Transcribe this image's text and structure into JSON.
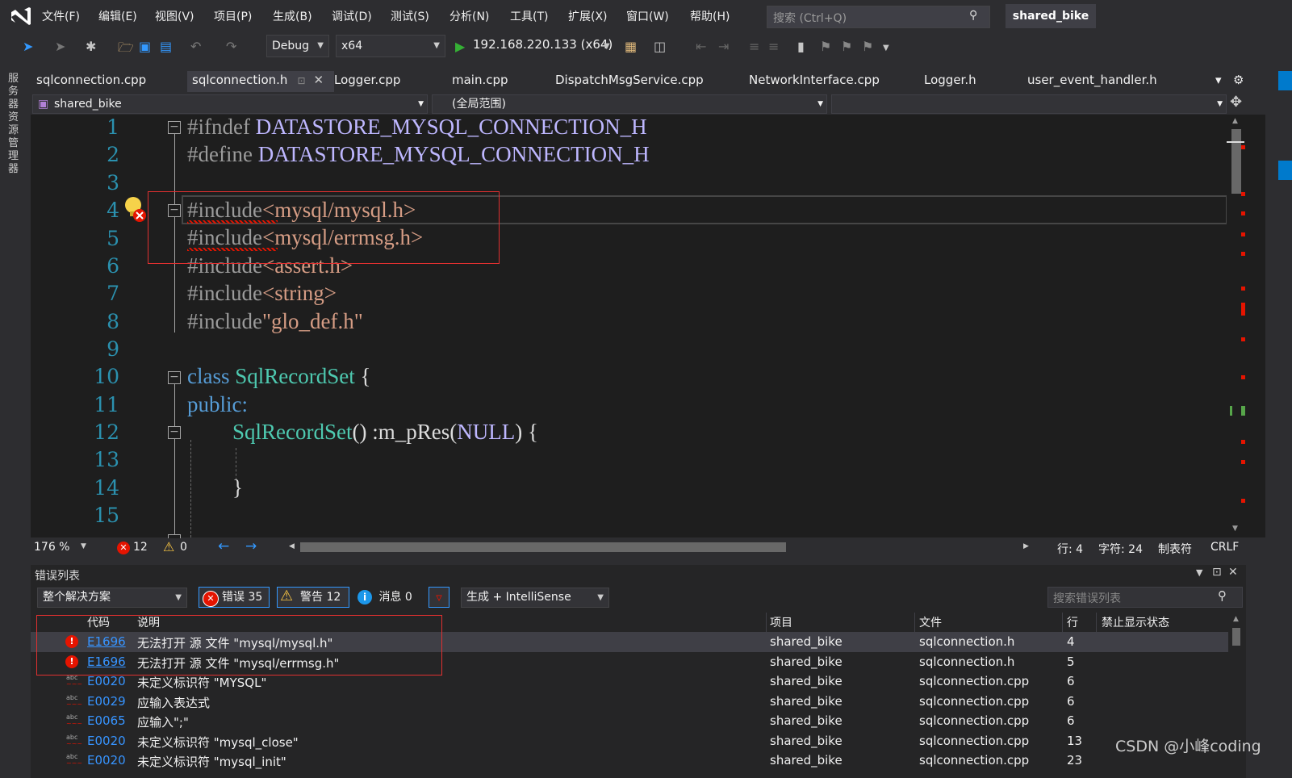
{
  "menu": [
    "文件(F)",
    "编辑(E)",
    "视图(V)",
    "项目(P)",
    "生成(B)",
    "调试(D)",
    "测试(S)",
    "分析(N)",
    "工具(T)",
    "扩展(X)",
    "窗口(W)",
    "帮助(H)"
  ],
  "search": {
    "placeholder": "搜索 (Ctrl+Q)"
  },
  "project_name": "shared_bike",
  "toolbar": {
    "config": "Debug",
    "platform": "x64",
    "run_target": "192.168.220.133 (x64)"
  },
  "left_sidebar_label": "服务器资源管理器",
  "tabs": [
    "sqlconnection.cpp",
    "sqlconnection.h",
    "Logger.cpp",
    "main.cpp",
    "DispatchMsgService.cpp",
    "NetworkInterface.cpp",
    "Logger.h",
    "user_event_handler.h"
  ],
  "active_tab": "sqlconnection.h",
  "nav": {
    "project": "shared_bike",
    "scope": "(全局范围)"
  },
  "line_numbers": [
    "1",
    "2",
    "3",
    "4",
    "5",
    "6",
    "7",
    "8",
    "9",
    "10",
    "11",
    "12",
    "13",
    "14",
    "15"
  ],
  "code": {
    "l1_dir": "#ifndef",
    "l1_mac": "DATASTORE_MYSQL_CONNECTION_H",
    "l2_dir": "#define",
    "l2_mac": "DATASTORE_MYSQL_CONNECTION_H",
    "l4_dir": "#include",
    "l4_str": "<mysql/mysql.h>",
    "l5_dir": "#include",
    "l5_str": "<mysql/errmsg.h>",
    "l6_dir": "#include",
    "l6_str": "<assert.h>",
    "l7_dir": "#include",
    "l7_str": "<string>",
    "l8_dir": "#include",
    "l8_str": "\"glo_def.h\"",
    "l10_kw": "class",
    "l10_ty": "SqlRecordSet",
    "l10_rest": "{",
    "l11_kw": "public:",
    "l12_ty": "SqlRecordSet",
    "l12_a": "()",
    "l12_b": " :m_pRes(",
    "l12_mac": "NULL",
    "l12_c": ")",
    "l12_d": "{",
    "l14": "}"
  },
  "status": {
    "zoom": "176 %",
    "errors": "12",
    "warnings": "0",
    "line": "行: 4",
    "char": "字符: 24",
    "tabs": "制表符",
    "eol": "CRLF"
  },
  "error_list": {
    "title": "错误列表",
    "scope": "整个解决方案",
    "errors_btn": "错误 35",
    "warnings_btn": "警告 12",
    "messages_btn": "消息 0",
    "source": "生成 + IntelliSense",
    "search_placeholder": "搜索错误列表",
    "columns": {
      "code": "代码",
      "desc": "说明",
      "project": "项目",
      "file": "文件",
      "line": "行",
      "suppress": "禁止显示状态"
    },
    "rows": [
      {
        "code": "E1696",
        "desc": "无法打开 源 文件 \"mysql/mysql.h\"",
        "project": "shared_bike",
        "file": "sqlconnection.h",
        "line": "4"
      },
      {
        "code": "E1696",
        "desc": "无法打开 源 文件 \"mysql/errmsg.h\"",
        "project": "shared_bike",
        "file": "sqlconnection.h",
        "line": "5"
      },
      {
        "code": "E0020",
        "desc": "未定义标识符 \"MYSQL\"",
        "project": "shared_bike",
        "file": "sqlconnection.cpp",
        "line": "6"
      },
      {
        "code": "E0029",
        "desc": "应输入表达式",
        "project": "shared_bike",
        "file": "sqlconnection.cpp",
        "line": "6"
      },
      {
        "code": "E0065",
        "desc": "应输入\";\"",
        "project": "shared_bike",
        "file": "sqlconnection.cpp",
        "line": "6"
      },
      {
        "code": "E0020",
        "desc": "未定义标识符 \"mysql_close\"",
        "project": "shared_bike",
        "file": "sqlconnection.cpp",
        "line": "13"
      },
      {
        "code": "E0020",
        "desc": "未定义标识符 \"mysql_init\"",
        "project": "shared_bike",
        "file": "sqlconnection.cpp",
        "line": "23"
      }
    ]
  },
  "watermark": "CSDN @小峰coding"
}
